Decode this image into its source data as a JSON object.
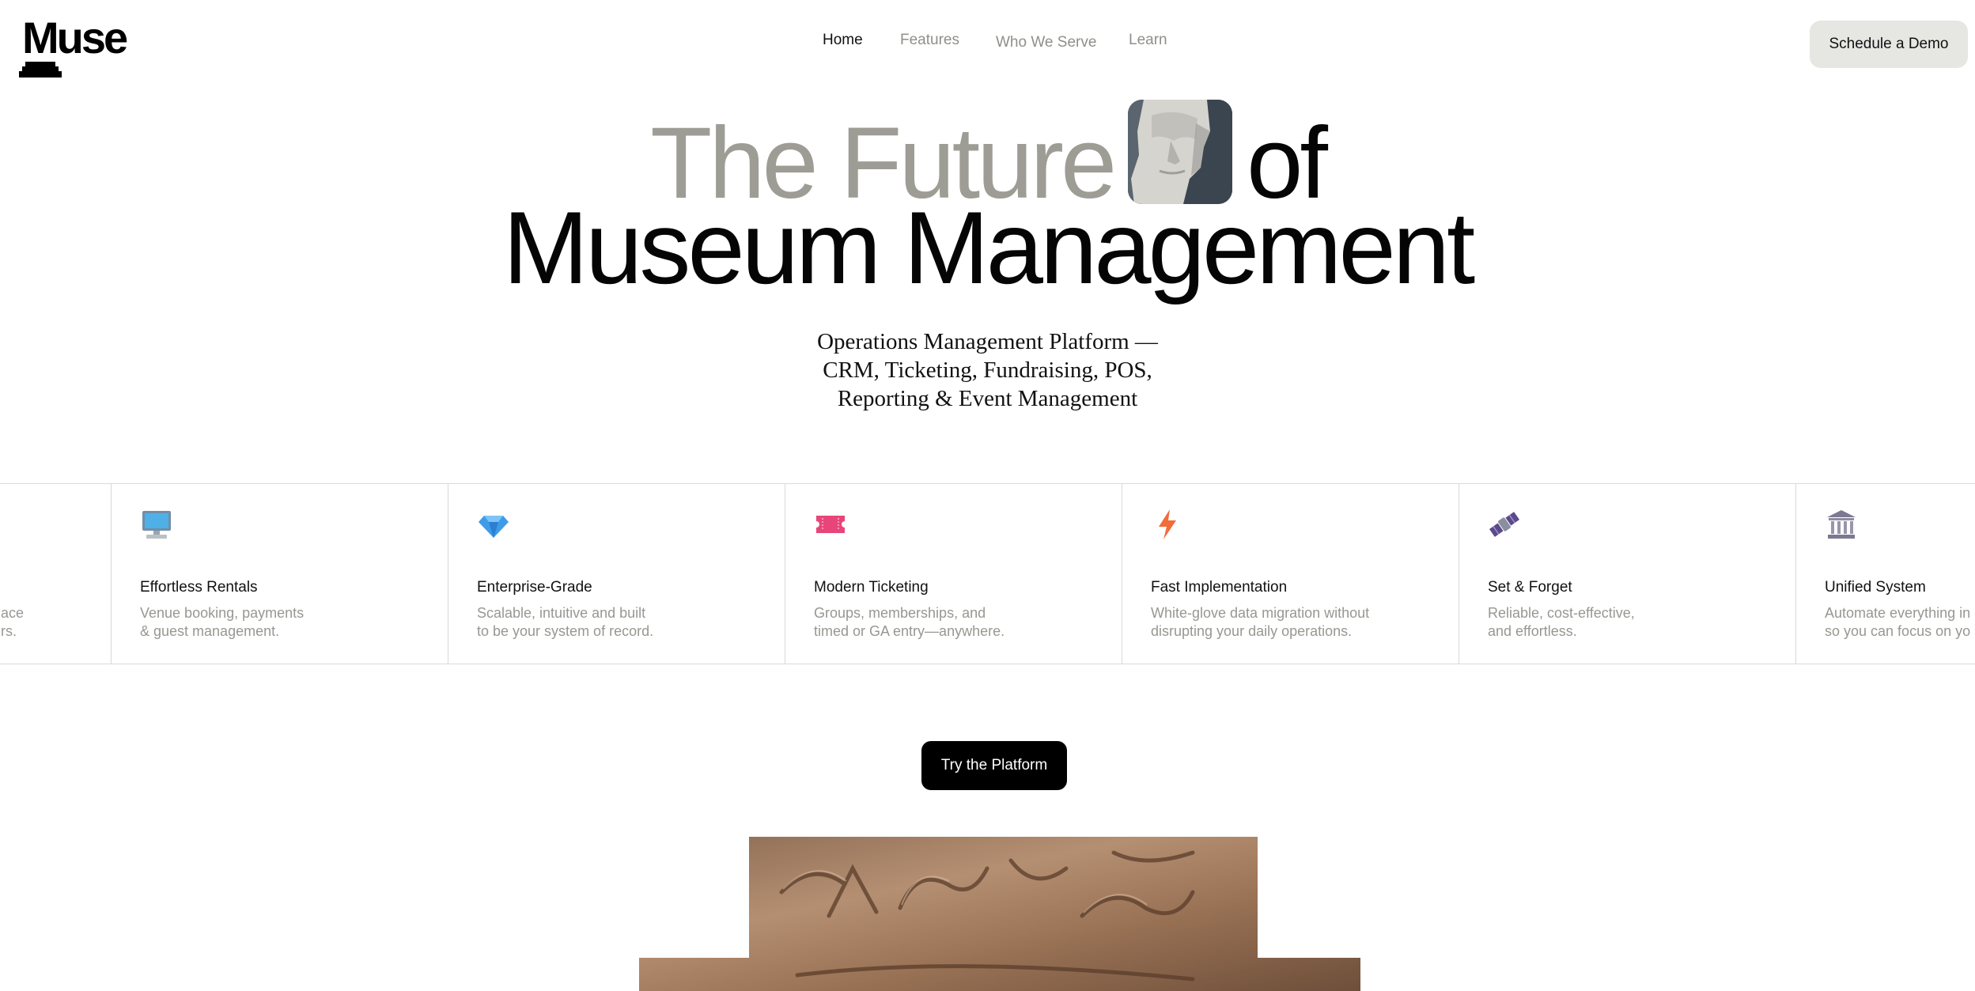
{
  "brand": {
    "name": "Muse"
  },
  "nav": {
    "items": [
      {
        "label": "Home",
        "active": true
      },
      {
        "label": "Features",
        "active": false
      },
      {
        "label": "Who We Serve",
        "active": false
      },
      {
        "label": "Learn",
        "active": false
      }
    ],
    "cta_label": "Schedule a Demo"
  },
  "hero": {
    "title_part1": "The Future",
    "title_part2": "of",
    "title_line2": "Museum Management",
    "subtitle_lines": [
      "Operations Management Platform —",
      "CRM, Ticketing, Fundraising, POS,",
      "Reporting & Event Management"
    ]
  },
  "features": [
    {
      "icon": "partial-feature-icon",
      "title": "",
      "desc1": "ace",
      "desc2": "rs."
    },
    {
      "icon": "computer-icon",
      "title": "Effortless Rentals",
      "desc1": "Venue booking, payments",
      "desc2": "& guest management."
    },
    {
      "icon": "gem-icon",
      "title": "Enterprise-Grade",
      "desc1": "Scalable, intuitive and built",
      "desc2": "to be your system of record."
    },
    {
      "icon": "ticket-icon",
      "title": "Modern Ticketing",
      "desc1": "Groups, memberships, and",
      "desc2": "timed or GA entry—anywhere."
    },
    {
      "icon": "lightning-icon",
      "title": "Fast Implementation",
      "desc1": "White-glove data migration without",
      "desc2": "disrupting your daily operations."
    },
    {
      "icon": "satellite-icon",
      "title": "Set & Forget",
      "desc1": "Reliable, cost-effective,",
      "desc2": "and effortless."
    },
    {
      "icon": "museum-building-icon",
      "title": "Unified System",
      "desc1": "Automate everything in",
      "desc2": "so you can focus on yo"
    }
  ],
  "cta": {
    "label": "Try the Platform"
  },
  "colors": {
    "grey_text": "#9d9d96",
    "muted_text": "#979792",
    "button_bg": "#e6e6e3",
    "cta_bg": "#000000"
  }
}
